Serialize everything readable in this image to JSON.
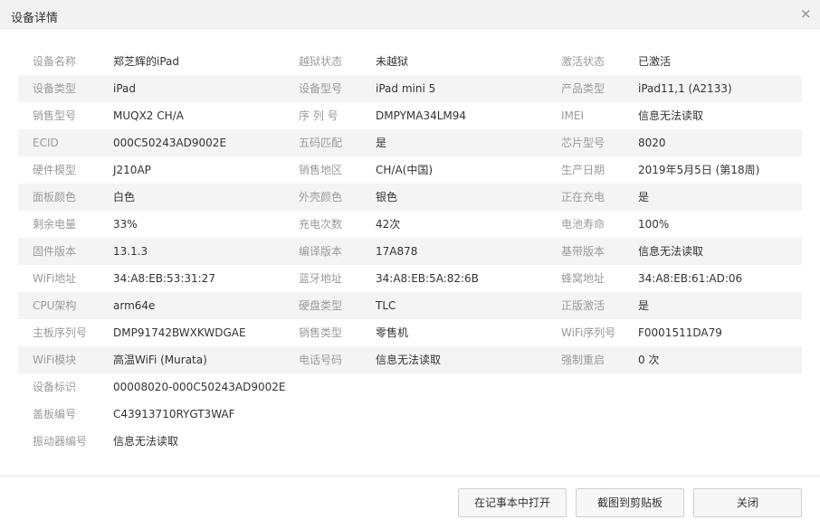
{
  "dialog": {
    "title": "设备详情",
    "close_glyph": "×"
  },
  "rows": [
    {
      "cells": [
        {
          "label": "设备名称",
          "value": "郑芝辉的iPad"
        },
        {
          "label": "越狱状态",
          "value": "未越狱"
        },
        {
          "label": "激活状态",
          "value": "已激活"
        }
      ]
    },
    {
      "cells": [
        {
          "label": "设备类型",
          "value": "iPad"
        },
        {
          "label": "设备型号",
          "value": "iPad mini 5"
        },
        {
          "label": "产品类型",
          "value": "iPad11,1 (A2133)"
        }
      ]
    },
    {
      "cells": [
        {
          "label": "销售型号",
          "value": "MUQX2 CH/A"
        },
        {
          "label": "序 列 号",
          "value": "DMPYMA34LM94"
        },
        {
          "label": "IMEI",
          "value": "信息无法读取"
        }
      ]
    },
    {
      "cells": [
        {
          "label": "ECID",
          "value": "000C50243AD9002E"
        },
        {
          "label": "五码匹配",
          "value": "是"
        },
        {
          "label": "芯片型号",
          "value": "8020"
        }
      ]
    },
    {
      "cells": [
        {
          "label": "硬件模型",
          "value": "J210AP"
        },
        {
          "label": "销售地区",
          "value": "CH/A(中国)"
        },
        {
          "label": "生产日期",
          "value": "2019年5月5日 (第18周)"
        }
      ]
    },
    {
      "cells": [
        {
          "label": "面板颜色",
          "value": "白色"
        },
        {
          "label": "外壳颜色",
          "value": "银色"
        },
        {
          "label": "正在充电",
          "value": "是"
        }
      ]
    },
    {
      "cells": [
        {
          "label": "剩余电量",
          "value": "33%"
        },
        {
          "label": "充电次数",
          "value": "42次"
        },
        {
          "label": "电池寿命",
          "value": "100%"
        }
      ]
    },
    {
      "cells": [
        {
          "label": "固件版本",
          "value": "13.1.3"
        },
        {
          "label": "编译版本",
          "value": "17A878"
        },
        {
          "label": "基带版本",
          "value": "信息无法读取"
        }
      ]
    },
    {
      "cells": [
        {
          "label": "WiFi地址",
          "value": "34:A8:EB:53:31:27"
        },
        {
          "label": "蓝牙地址",
          "value": "34:A8:EB:5A:82:6B"
        },
        {
          "label": "蜂窝地址",
          "value": "34:A8:EB:61:AD:06"
        }
      ]
    },
    {
      "cells": [
        {
          "label": "CPU架构",
          "value": "arm64e"
        },
        {
          "label": "硬盘类型",
          "value": "TLC"
        },
        {
          "label": "正版激活",
          "value": "是"
        }
      ]
    },
    {
      "cells": [
        {
          "label": "主板序列号",
          "value": "DMP91742BWXKWDGAE"
        },
        {
          "label": "销售类型",
          "value": "零售机"
        },
        {
          "label": "WiFi序列号",
          "value": "F0001511DA79"
        }
      ]
    },
    {
      "cells": [
        {
          "label": "WiFi模块",
          "value": "高温WiFi (Murata)"
        },
        {
          "label": "电话号码",
          "value": "信息无法读取"
        },
        {
          "label": "强制重启",
          "value": "0 次"
        }
      ]
    },
    {
      "cells": [
        {
          "label": "设备标识",
          "value": "00008020-000C50243AD9002E"
        }
      ]
    },
    {
      "cells": [
        {
          "label": "盖板编号",
          "value": "C43913710RYGT3WAF"
        }
      ]
    },
    {
      "cells": [
        {
          "label": "振动器编号",
          "value": "信息无法读取"
        }
      ]
    }
  ],
  "footer": {
    "open_in_notepad_label": "在记事本中打开",
    "copy_screenshot_label": "截图到剪贴板",
    "close_label": "关闭"
  }
}
